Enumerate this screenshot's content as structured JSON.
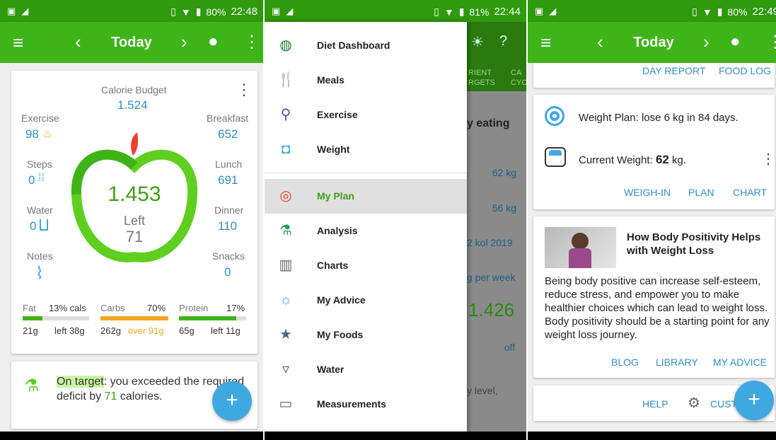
{
  "panel1": {
    "status": {
      "battery": "80%",
      "time": "22:48"
    },
    "appbar": {
      "title": "Today"
    },
    "budget": {
      "label": "Calorie Budget",
      "value": "1.524"
    },
    "exercise": {
      "label": "Exercise",
      "value": "98"
    },
    "steps": {
      "label": "Steps",
      "value": "0"
    },
    "water": {
      "label": "Water",
      "value": "0"
    },
    "notes": {
      "label": "Notes"
    },
    "breakfast": {
      "label": "Breakfast",
      "value": "652"
    },
    "lunch": {
      "label": "Lunch",
      "value": "691"
    },
    "dinner": {
      "label": "Dinner",
      "value": "110"
    },
    "snacks": {
      "label": "Snacks",
      "value": "0"
    },
    "center": {
      "value": "1.453",
      "label": "Left",
      "sub": "71"
    },
    "macros": {
      "fat": {
        "label": "Fat",
        "pct": "13% cals",
        "g": "21g",
        "left": "left 38g",
        "fill": 0.3
      },
      "carbs": {
        "label": "Carbs",
        "pct": "70%",
        "g": "262g",
        "left": "over 91g",
        "fill": 1.0
      },
      "protein": {
        "label": "Protein",
        "pct": "17%",
        "g": "65g",
        "left": "left 11g",
        "fill": 0.85
      }
    },
    "tip": {
      "highlight": "On target",
      "text1": ": you exceeded the required",
      "text2a": "deficit by ",
      "num": "71",
      "text2b": " calories."
    },
    "colors": {
      "green": "#3fb418",
      "blue": "#2f8fc7",
      "orange": "#f5a623",
      "red": "#e8412c"
    }
  },
  "panel2": {
    "status": {
      "battery": "81%",
      "time": "22:44"
    },
    "drawer": [
      {
        "label": "Diet Dashboard",
        "icon": "dashboard-icon"
      },
      {
        "label": "Meals",
        "icon": "fork-knife-icon"
      },
      {
        "label": "Exercise",
        "icon": "bike-icon"
      },
      {
        "label": "Weight",
        "icon": "scale-icon"
      },
      {
        "label": "My Plan",
        "icon": "target-icon"
      },
      {
        "label": "Analysis",
        "icon": "microscope-icon"
      },
      {
        "label": "Charts",
        "icon": "bar-chart-icon"
      },
      {
        "label": "My Advice",
        "icon": "lightbulb-icon"
      },
      {
        "label": "My Foods",
        "icon": "star-icon"
      },
      {
        "label": "Water",
        "icon": "glass-icon"
      },
      {
        "label": "Measurements",
        "icon": "tape-icon"
      }
    ],
    "background": {
      "tab1": "RIENT",
      "tab1b": "RGETS",
      "tab2": "CA",
      "tab2b": "CYC",
      "heading": "y eating",
      "v1": "62 kg",
      "v2": "56 kg",
      "v3": "2 kol 2019",
      "v4": "g per week",
      "big": "1.426",
      "off": "off",
      "lvl": "y level,"
    }
  },
  "panel3": {
    "status": {
      "battery": "80%",
      "time": "22:49"
    },
    "appbar": {
      "title": "Today"
    },
    "top_links": {
      "a": "DAY REPORT",
      "b": "FOOD LOG"
    },
    "plan": {
      "text": "Weight Plan: lose 6 kg in 84 days.",
      "current_label": "Current Weight: ",
      "current_val": "62",
      "unit": " kg.",
      "b1": "WEIGH-IN",
      "b2": "PLAN",
      "b3": "CHART"
    },
    "article": {
      "title": "How Body Positivity Helps with Weight Loss",
      "body": "Being body positive can increase self-esteem, reduce stress, and empower you to make healthier choices which can lead to weight loss. Body positivity should be a starting point for any weight loss journey.",
      "b1": "BLOG",
      "b2": "LIBRARY",
      "b3": "MY ADVICE"
    },
    "footer": {
      "help": "HELP",
      "cust": "CUST"
    }
  }
}
